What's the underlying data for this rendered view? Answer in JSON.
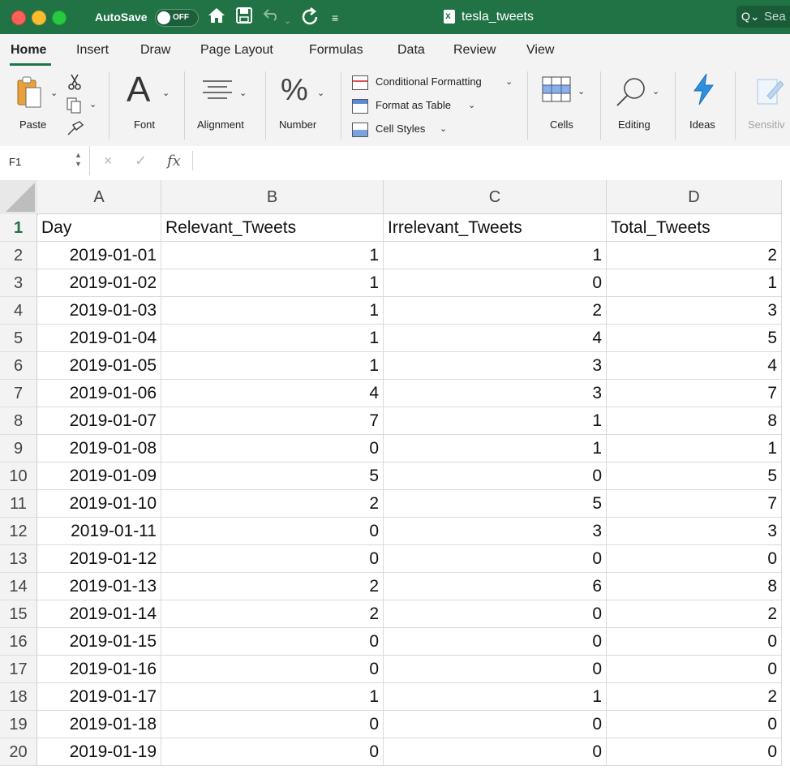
{
  "titlebar": {
    "autosave_label": "AutoSave",
    "autosave_state": "OFF",
    "doc_title": "tesla_tweets",
    "search_placeholder": "Sea",
    "accent": "#217346"
  },
  "tabs": [
    "Home",
    "Insert",
    "Draw",
    "Page Layout",
    "Formulas",
    "Data",
    "Review",
    "View"
  ],
  "ribbon": {
    "paste": "Paste",
    "font": "Font",
    "alignment": "Alignment",
    "number": "Number",
    "conditional_formatting": "Conditional Formatting",
    "format_as_table": "Format as Table",
    "cell_styles": "Cell Styles",
    "cells": "Cells",
    "editing": "Editing",
    "ideas": "Ideas",
    "sensitivity": "Sensitiv"
  },
  "formula_bar": {
    "name_box": "F1",
    "cancel": "×",
    "enter": "✓",
    "fx": "fx",
    "value": ""
  },
  "sheet": {
    "columns": [
      "A",
      "B",
      "C",
      "D"
    ],
    "selected_row": "1",
    "header_row": [
      "Day",
      "Relevant_Tweets",
      "Irrelevant_Tweets",
      "Total_Tweets"
    ],
    "rows": [
      {
        "n": "2",
        "day": "2019-01-01",
        "rel": "1",
        "irr": "1",
        "tot": "2"
      },
      {
        "n": "3",
        "day": "2019-01-02",
        "rel": "1",
        "irr": "0",
        "tot": "1"
      },
      {
        "n": "4",
        "day": "2019-01-03",
        "rel": "1",
        "irr": "2",
        "tot": "3"
      },
      {
        "n": "5",
        "day": "2019-01-04",
        "rel": "1",
        "irr": "4",
        "tot": "5"
      },
      {
        "n": "6",
        "day": "2019-01-05",
        "rel": "1",
        "irr": "3",
        "tot": "4"
      },
      {
        "n": "7",
        "day": "2019-01-06",
        "rel": "4",
        "irr": "3",
        "tot": "7"
      },
      {
        "n": "8",
        "day": "2019-01-07",
        "rel": "7",
        "irr": "1",
        "tot": "8"
      },
      {
        "n": "9",
        "day": "2019-01-08",
        "rel": "0",
        "irr": "1",
        "tot": "1"
      },
      {
        "n": "10",
        "day": "2019-01-09",
        "rel": "5",
        "irr": "0",
        "tot": "5"
      },
      {
        "n": "11",
        "day": "2019-01-10",
        "rel": "2",
        "irr": "5",
        "tot": "7"
      },
      {
        "n": "12",
        "day": "2019-01-11",
        "rel": "0",
        "irr": "3",
        "tot": "3"
      },
      {
        "n": "13",
        "day": "2019-01-12",
        "rel": "0",
        "irr": "0",
        "tot": "0"
      },
      {
        "n": "14",
        "day": "2019-01-13",
        "rel": "2",
        "irr": "6",
        "tot": "8"
      },
      {
        "n": "15",
        "day": "2019-01-14",
        "rel": "2",
        "irr": "0",
        "tot": "2"
      },
      {
        "n": "16",
        "day": "2019-01-15",
        "rel": "0",
        "irr": "0",
        "tot": "0"
      },
      {
        "n": "17",
        "day": "2019-01-16",
        "rel": "0",
        "irr": "0",
        "tot": "0"
      },
      {
        "n": "18",
        "day": "2019-01-17",
        "rel": "1",
        "irr": "1",
        "tot": "2"
      },
      {
        "n": "19",
        "day": "2019-01-18",
        "rel": "0",
        "irr": "0",
        "tot": "0"
      },
      {
        "n": "20",
        "day": "2019-01-19",
        "rel": "0",
        "irr": "0",
        "tot": "0"
      }
    ]
  }
}
